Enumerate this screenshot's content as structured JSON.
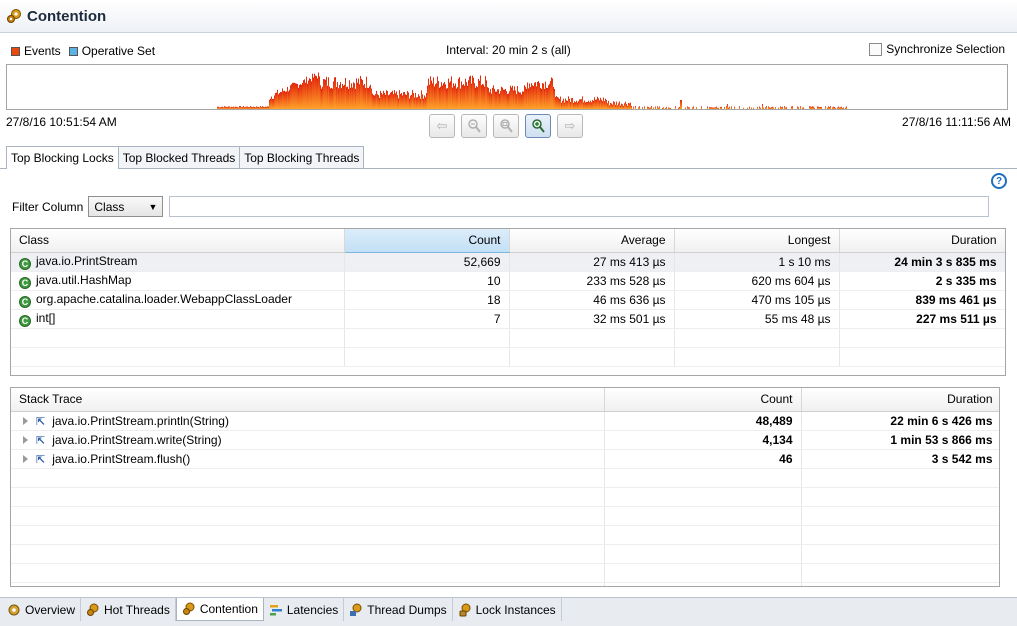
{
  "header": {
    "title": "Contention"
  },
  "legend": {
    "events": "Events",
    "operative": "Operative Set",
    "events_color": "#e84a10",
    "operative_color": "#5bb3e3"
  },
  "interval": "Interval: 20 min 2 s (all)",
  "sync": "Synchronize Selection",
  "time_start": "27/8/16 10:51:54 AM",
  "time_end": "27/8/16 11:11:56 AM",
  "nav": [
    "back-icon",
    "zoom-out-icon",
    "zoom-reset-icon",
    "zoom-in-icon",
    "forward-icon"
  ],
  "tabs": [
    "Top Blocking Locks",
    "Top Blocked Threads",
    "Top Blocking Threads"
  ],
  "filter": {
    "label": "Filter Column",
    "selected": "Class"
  },
  "locks_table": {
    "columns": [
      "Class",
      "Count",
      "Average",
      "Longest",
      "Duration"
    ],
    "rows": [
      [
        "java.io.PrintStream",
        "52,669",
        "27 ms 413 µs",
        "1 s 10 ms",
        "24 min 3 s 835 ms"
      ],
      [
        "java.util.HashMap",
        "10",
        "233 ms 528 µs",
        "620 ms 604 µs",
        "2 s 335 ms"
      ],
      [
        "org.apache.catalina.loader.WebappClassLoader",
        "18",
        "46 ms 636 µs",
        "470 ms 105 µs",
        "839 ms 461 µs"
      ],
      [
        "int[]",
        "7",
        "32 ms 501 µs",
        "55 ms 48 µs",
        "227 ms 511 µs"
      ]
    ]
  },
  "stack_table": {
    "columns": [
      "Stack Trace",
      "Count",
      "Duration"
    ],
    "rows": [
      [
        "java.io.PrintStream.println(String)",
        "48,489",
        "22 min 6 s 426 ms"
      ],
      [
        "java.io.PrintStream.write(String)",
        "4,134",
        "1 min 53 s 866 ms"
      ],
      [
        "java.io.PrintStream.flush()",
        "46",
        "3 s 542 ms"
      ]
    ]
  },
  "bottom_tabs": [
    "Overview",
    "Hot Threads",
    "Contention",
    "Latencies",
    "Thread Dumps",
    "Lock Instances"
  ]
}
